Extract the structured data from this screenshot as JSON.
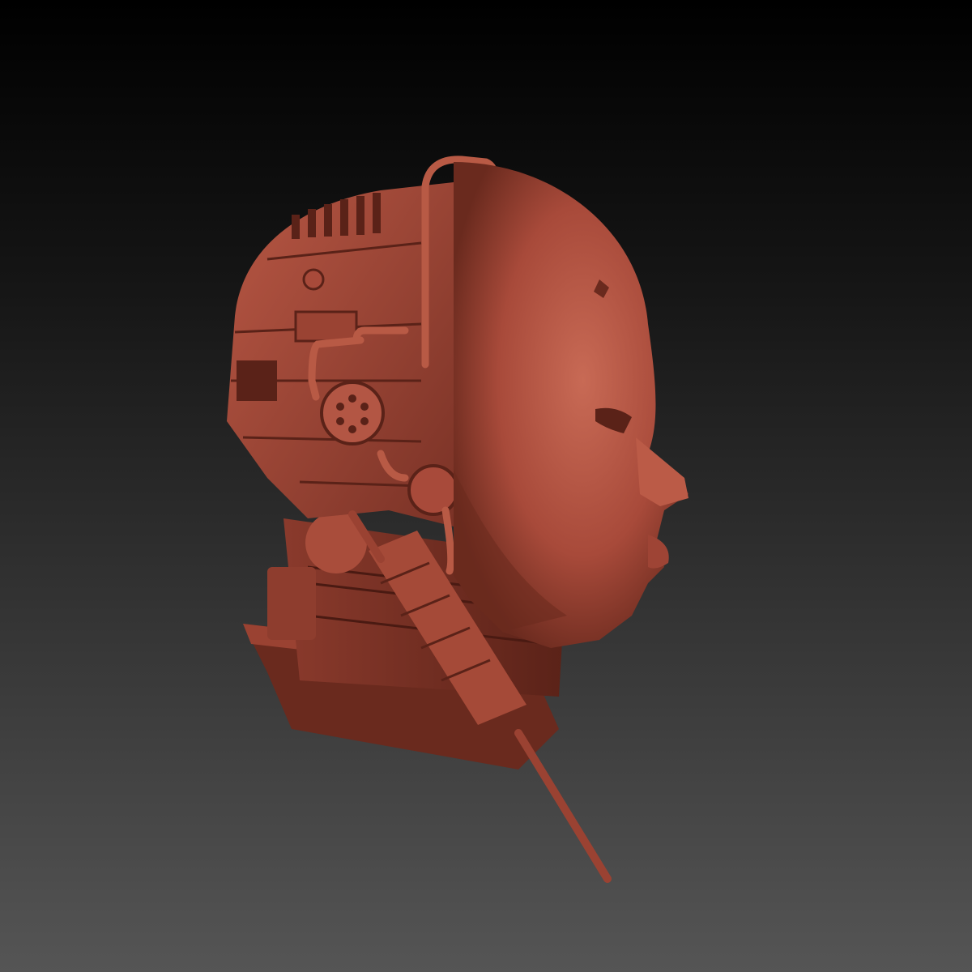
{
  "scene": {
    "subject": "sculpt-head-cyborg",
    "colors": {
      "background_top": "#000000",
      "background_bottom": "#555555",
      "clay_light": "#c6614e",
      "clay_mid": "#a84a3a",
      "clay_dark": "#6e2a1f",
      "clay_shadow": "#4a1a12"
    }
  }
}
